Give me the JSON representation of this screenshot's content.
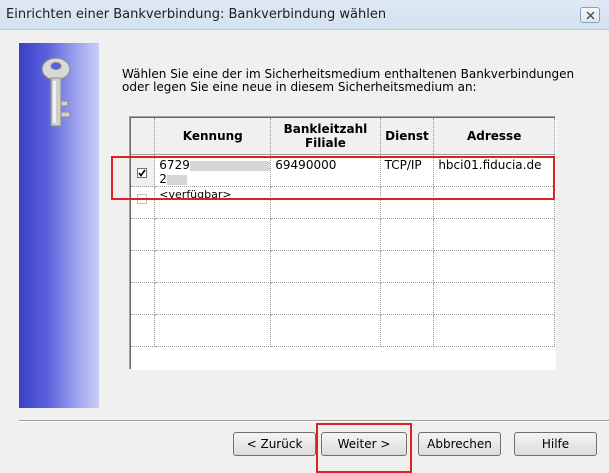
{
  "window": {
    "title": "Einrichten einer Bankverbindung: Bankverbindung wählen"
  },
  "instructions": {
    "line1": "Wählen Sie eine der im Sicherheitsmedium enthaltenen Bankverbindungen",
    "line2": "oder legen Sie eine neue in diesem Sicherheitsmedium an:"
  },
  "table": {
    "headers": {
      "kennung": "Kennung",
      "blz_line1": "Bankleitzahl",
      "blz_line2": "Filiale",
      "dienst": "Dienst",
      "adresse": "Adresse"
    },
    "rows": [
      {
        "checked": true,
        "kennung_line1": "6729",
        "kennung_line2": "2",
        "blz": "69490000",
        "dienst": "TCP/IP",
        "adresse": "hbci01.fiducia.de"
      },
      {
        "checked": false,
        "kennung_line1": "<verfügbar>"
      }
    ]
  },
  "buttons": {
    "back": "< Zurück",
    "next": "Weiter >",
    "cancel": "Abbrechen",
    "help": "Hilfe"
  },
  "colors": {
    "highlight": "#e02020",
    "side_panel": "#3b3fc7"
  },
  "icons": [
    "close-icon",
    "key-icon",
    "checkbox-checked",
    "checkbox-empty"
  ]
}
